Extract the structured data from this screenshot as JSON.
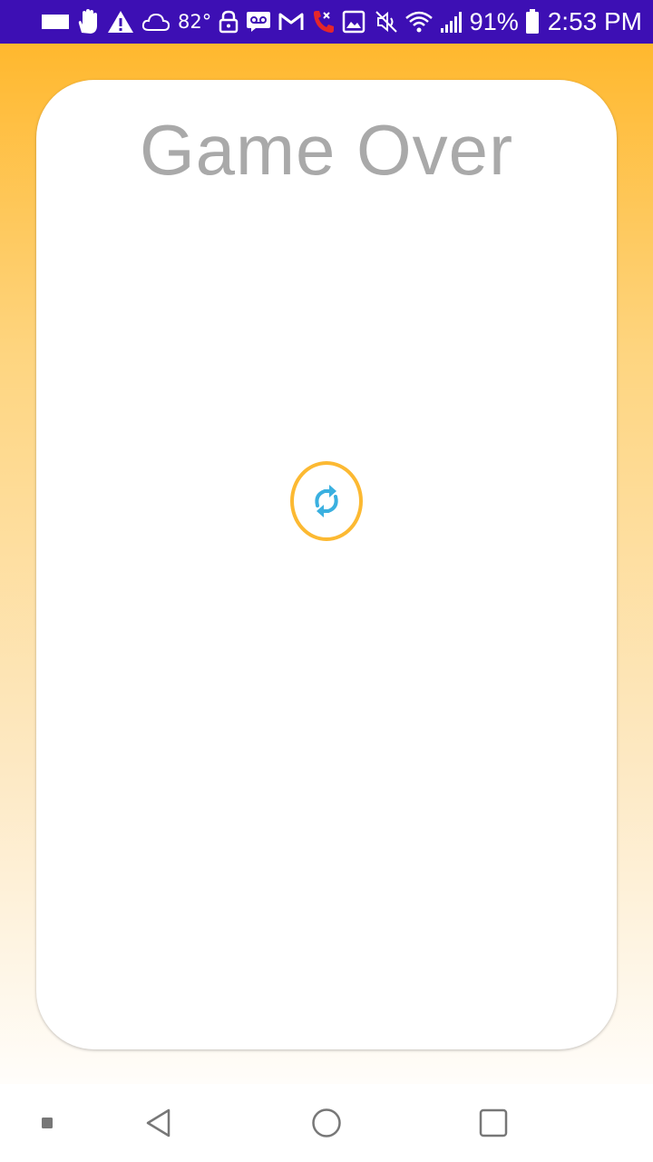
{
  "status_bar": {
    "temperature": "82°",
    "battery_percent": "91%",
    "time": "2:53 PM",
    "background_color": "#3d0fb4",
    "icons": [
      "notification-square-icon",
      "hand-icon",
      "warning-icon",
      "cloud-icon",
      "lock-icon",
      "voicemail-icon",
      "gmail-icon",
      "missed-call-icon",
      "image-icon",
      "mute-icon",
      "wifi-icon",
      "signal-icon",
      "battery-icon"
    ]
  },
  "game": {
    "title": "Game Over",
    "restart_icon": "refresh-icon",
    "accent_color": "#fcb932",
    "icon_color": "#3ab0e0"
  },
  "nav_bar": {
    "icons": [
      "recent-dot-icon",
      "back-icon",
      "home-icon",
      "overview-icon"
    ]
  }
}
